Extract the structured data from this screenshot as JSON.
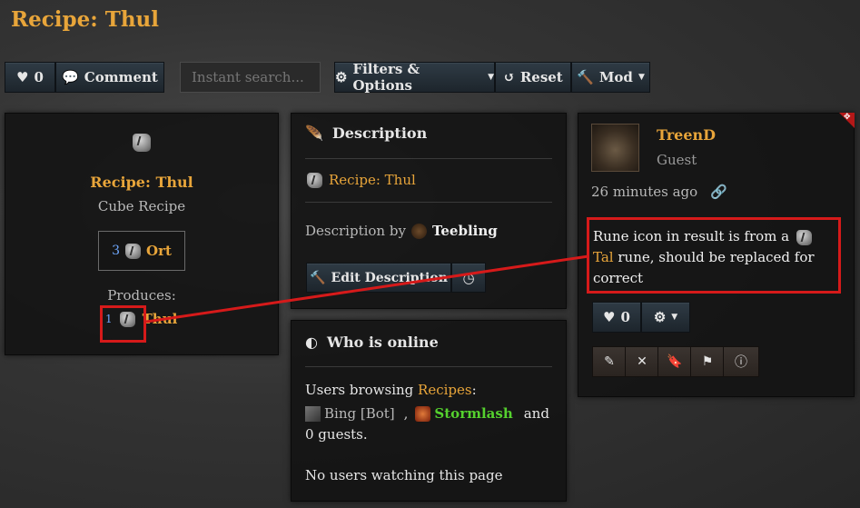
{
  "page": {
    "title": "Recipe: Thul"
  },
  "toolbar": {
    "like_count": "0",
    "comment_label": "Comment",
    "search_placeholder": "Instant search...",
    "filters_label": "Filters & Options",
    "reset_label": "Reset",
    "mod_label": "Mod"
  },
  "recipe_card": {
    "name": "Recipe: Thul",
    "type": "Cube Recipe",
    "ingredient_qty": "3",
    "ingredient_name": "Ort",
    "produces_label": "Produces:",
    "result_qty": "1",
    "result_name": "Thul"
  },
  "description_panel": {
    "heading": "Description",
    "item_name": "Recipe: Thul",
    "description_by_label": "Description by",
    "author": "Teebling",
    "edit_label": "Edit Description"
  },
  "online_panel": {
    "heading": "Who is online",
    "browsing_prefix": "Users browsing",
    "browsing_link": "Recipes",
    "browsing_suffix": ":",
    "user1": "Bing [Bot]",
    "separator": ",",
    "user2": "Stormlash",
    "and_label": "and",
    "guests": "0 guests.",
    "watching": "No users watching this page"
  },
  "comment": {
    "username": "TreenD",
    "role": "Guest",
    "time": "26 minutes ago",
    "text_before": "Rune icon in result is from a",
    "text_link": "Tal",
    "text_after": "rune, should be replaced for correct",
    "like_count": "0"
  },
  "colors": {
    "accent_gold": "#e8a53a",
    "online_green": "#55d12e",
    "annotation_red": "#d61a1a"
  }
}
